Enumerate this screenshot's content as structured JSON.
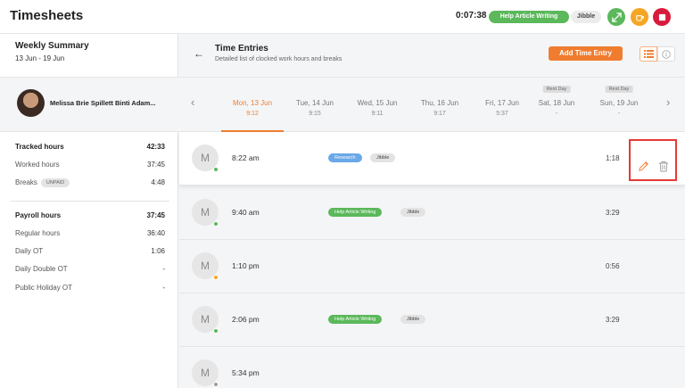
{
  "app": {
    "title": "Timesheets"
  },
  "topbar": {
    "timer": "0:07:38",
    "activity": "Help Article Writing",
    "project": "Jibble",
    "buttons": [
      {
        "icon": "expand-icon",
        "color": "#5bb85b"
      },
      {
        "icon": "coffee-icon",
        "color": "#f5a623"
      },
      {
        "icon": "stop-icon",
        "color": "#d81b3c"
      }
    ]
  },
  "summary": {
    "title": "Weekly Summary",
    "range": "13 Jun - 19 Jun",
    "user_name": "Melissa Brie Spillett Binti Adam...",
    "tracked_label": "Tracked hours",
    "tracked_value": "42:33",
    "worked_label": "Worked hours",
    "worked_value": "37:45",
    "breaks_label": "Breaks",
    "breaks_badge": "UNPAID",
    "breaks_value": "4:48",
    "payroll_label": "Payroll hours",
    "payroll_value": "37:45",
    "regular_label": "Regular hours",
    "regular_value": "36:40",
    "daily_ot_label": "Daily OT",
    "daily_ot_value": "1:06",
    "daily_double_ot_label": "Daily Double OT",
    "daily_double_ot_value": "-",
    "public_holiday_ot_label": "Public Holiday OT",
    "public_holiday_ot_value": "-"
  },
  "main": {
    "title": "Time Entries",
    "subtitle": "Detailed list of clocked work hours and breaks",
    "add_button": "Add Time Entry"
  },
  "days": [
    {
      "name": "Mon, 13 Jun",
      "hours": "9:12",
      "rest": "",
      "active": true
    },
    {
      "name": "Tue, 14 Jun",
      "hours": "9:15",
      "rest": "",
      "active": false
    },
    {
      "name": "Wed, 15 Jun",
      "hours": "9:11",
      "rest": "",
      "active": false
    },
    {
      "name": "Thu, 16 Jun",
      "hours": "9:17",
      "rest": "",
      "active": false
    },
    {
      "name": "Fri, 17 Jun",
      "hours": "5:37",
      "rest": "",
      "active": false
    },
    {
      "name": "Sat, 18 Jun",
      "hours": "-",
      "rest": "Rest Day",
      "active": false
    },
    {
      "name": "Sun, 19 Jun",
      "hours": "-",
      "rest": "Rest Day",
      "active": false
    }
  ],
  "entries": [
    {
      "avatar": "M",
      "time": "8:22 am",
      "status": "#5bb85b",
      "activity": "Research",
      "activity_color": "blue",
      "project": "Jibble",
      "duration": "1:18"
    },
    {
      "avatar": "M",
      "time": "9:40 am",
      "status": "#5bb85b",
      "activity": "Help Article Writing",
      "activity_color": "green",
      "project": "Jibble",
      "duration": "3:29"
    },
    {
      "avatar": "M",
      "time": "1:10 pm",
      "status": "#f5a623",
      "activity": "",
      "activity_color": "",
      "project": "",
      "duration": "0:56"
    },
    {
      "avatar": "M",
      "time": "2:06 pm",
      "status": "#5bb85b",
      "activity": "Help Article Writing",
      "activity_color": "green",
      "project": "Jibble",
      "duration": "3:29"
    },
    {
      "avatar": "M",
      "time": "5:34 pm",
      "status": "#9e9e9e",
      "activity": "",
      "activity_color": "",
      "project": "",
      "duration": ""
    }
  ],
  "colors": {
    "accent": "#f07c30",
    "highlight_box": "#e53935"
  }
}
